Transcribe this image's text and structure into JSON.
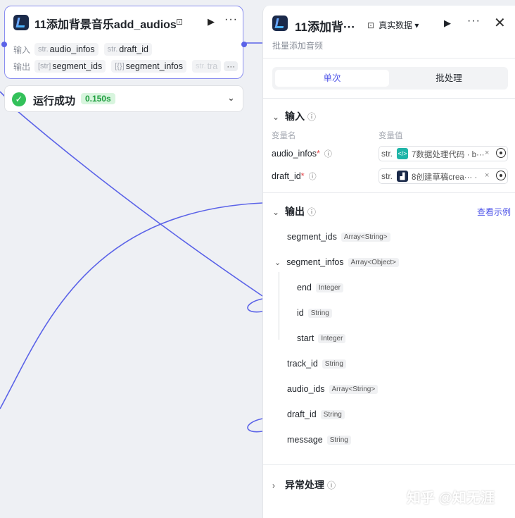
{
  "canvas": {
    "edge_color": "#5b63e8"
  },
  "node": {
    "title": "11添加背景音乐add_audios",
    "input_label": "输入",
    "output_label": "输出",
    "inputs": [
      {
        "type": "str.",
        "name": "audio_infos"
      },
      {
        "type": "str.",
        "name": "draft_id"
      }
    ],
    "outputs": [
      {
        "type": "[str]",
        "name": "segment_ids"
      },
      {
        "type": "[{}]",
        "name": "segment_infos"
      },
      {
        "type": "str.",
        "name": "tra"
      }
    ],
    "outputs_more": "···",
    "status_text": "运行成功",
    "status_time": "0.150s"
  },
  "panel": {
    "title": "11添加背···",
    "data_mode": "真实数据",
    "subtitle": "批量添加音频",
    "tab_single": "单次",
    "tab_batch": "批处理",
    "input_section": "输入",
    "col_var_name": "变量名",
    "col_var_value": "变量值",
    "inputs": [
      {
        "name": "audio_infos",
        "pre": "str.",
        "value": "7数据处理代码 · b···",
        "icon_color": "#1fb5a8",
        "icon_glyph": "</>"
      },
      {
        "name": "draft_id",
        "pre": "str.",
        "value": "8创建草稿crea··· ·",
        "icon_color": "#1b2a4a",
        "icon_glyph": "▟"
      }
    ],
    "output_section": "输出",
    "view_example": "查看示例",
    "outputs": [
      {
        "name": "segment_ids",
        "type": "Array<String>"
      },
      {
        "name": "segment_infos",
        "type": "Array<Object>"
      },
      {
        "name": "end",
        "type": "Integer"
      },
      {
        "name": "id",
        "type": "String"
      },
      {
        "name": "start",
        "type": "Integer"
      },
      {
        "name": "track_id",
        "type": "String"
      },
      {
        "name": "audio_ids",
        "type": "Array<String>"
      },
      {
        "name": "draft_id",
        "type": "String"
      },
      {
        "name": "message",
        "type": "String"
      }
    ],
    "exception_section": "异常处理"
  },
  "watermark": "知乎 @知无涯"
}
